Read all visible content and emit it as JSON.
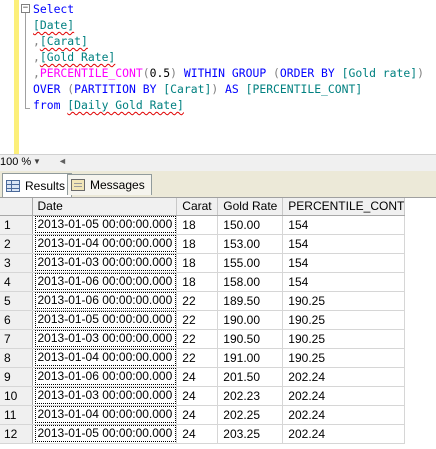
{
  "editor": {
    "lines": [
      [
        {
          "t": "Select",
          "c": "kw"
        }
      ],
      [
        {
          "t": "[Date]",
          "c": "ident squig"
        }
      ],
      [
        {
          "t": ",",
          "c": "gray"
        },
        {
          "t": "[Carat]",
          "c": "ident squig"
        }
      ],
      [
        {
          "t": ",",
          "c": "gray"
        },
        {
          "t": "[Gold Rate]",
          "c": "ident squig"
        }
      ],
      [
        {
          "t": ",",
          "c": "gray"
        },
        {
          "t": "PERCENTILE_CONT",
          "c": "fn"
        },
        {
          "t": "(",
          "c": "gray"
        },
        {
          "t": "0.5",
          "c": ""
        },
        {
          "t": ") ",
          "c": "gray"
        },
        {
          "t": "WITHIN GROUP",
          "c": "kw"
        },
        {
          "t": " (",
          "c": "gray"
        },
        {
          "t": "ORDER BY",
          "c": "kw"
        },
        {
          "t": " [Gold rate]",
          "c": "ident"
        },
        {
          "t": ")",
          "c": "gray"
        }
      ],
      [
        {
          "t": "OVER",
          "c": "kw"
        },
        {
          "t": " (",
          "c": "gray"
        },
        {
          "t": "PARTITION BY",
          "c": "kw"
        },
        {
          "t": " [Carat]",
          "c": "ident"
        },
        {
          "t": ") ",
          "c": "gray"
        },
        {
          "t": "AS",
          "c": "kw"
        },
        {
          "t": " [PERCENTILE_CONT]",
          "c": "ident"
        }
      ],
      [
        {
          "t": "from",
          "c": "kw"
        },
        {
          "t": " ",
          "c": ""
        },
        {
          "t": "[Daily Gold Rate]",
          "c": "ident squig"
        }
      ]
    ]
  },
  "zoom": {
    "value": "100 %",
    "arrow": "▼",
    "scroll_arrow": "◄"
  },
  "tabs": {
    "results": "Results",
    "messages": "Messages"
  },
  "grid": {
    "columns": [
      "Date",
      "Carat",
      "Gold Rate",
      "PERCENTILE_CONT"
    ],
    "rows": [
      [
        "1",
        "2013-01-05 00:00:00.000",
        "18",
        "150.00",
        "154"
      ],
      [
        "2",
        "2013-01-04 00:00:00.000",
        "18",
        "153.00",
        "154"
      ],
      [
        "3",
        "2013-01-03 00:00:00.000",
        "18",
        "155.00",
        "154"
      ],
      [
        "4",
        "2013-01-06 00:00:00.000",
        "18",
        "158.00",
        "154"
      ],
      [
        "5",
        "2013-01-06 00:00:00.000",
        "22",
        "189.50",
        "190.25"
      ],
      [
        "6",
        "2013-01-05 00:00:00.000",
        "22",
        "190.00",
        "190.25"
      ],
      [
        "7",
        "2013-01-03 00:00:00.000",
        "22",
        "190.50",
        "190.25"
      ],
      [
        "8",
        "2013-01-04 00:00:00.000",
        "22",
        "191.00",
        "190.25"
      ],
      [
        "9",
        "2013-01-06 00:00:00.000",
        "24",
        "201.50",
        "202.24"
      ],
      [
        "10",
        "2013-01-03 00:00:00.000",
        "24",
        "202.23",
        "202.24"
      ],
      [
        "11",
        "2013-01-04 00:00:00.000",
        "24",
        "202.25",
        "202.24"
      ],
      [
        "12",
        "2013-01-05 00:00:00.000",
        "24",
        "203.25",
        "202.24"
      ]
    ]
  }
}
